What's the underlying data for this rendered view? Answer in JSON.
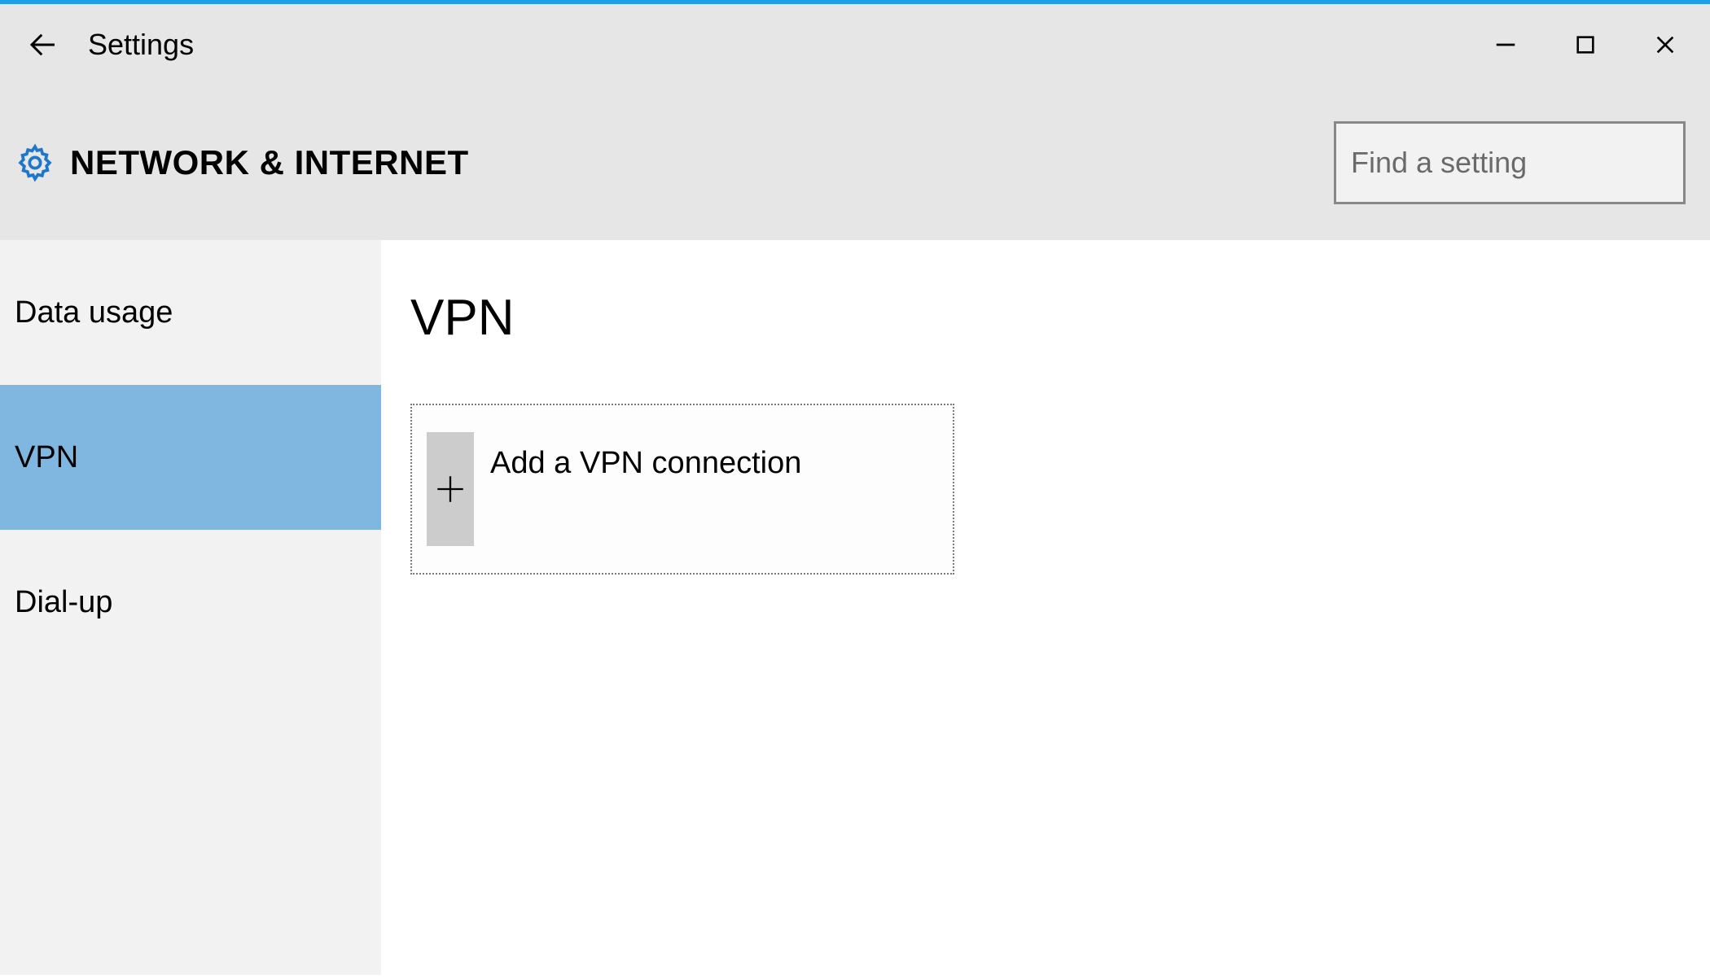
{
  "window": {
    "title": "Settings"
  },
  "header": {
    "category": "NETWORK & INTERNET"
  },
  "search": {
    "placeholder": "Find a setting"
  },
  "sidebar": {
    "items": [
      {
        "label": "Data usage",
        "selected": false
      },
      {
        "label": "VPN",
        "selected": true
      },
      {
        "label": "Dial-up",
        "selected": false
      }
    ]
  },
  "main": {
    "heading": "VPN",
    "add_button_label": "Add a VPN connection"
  }
}
